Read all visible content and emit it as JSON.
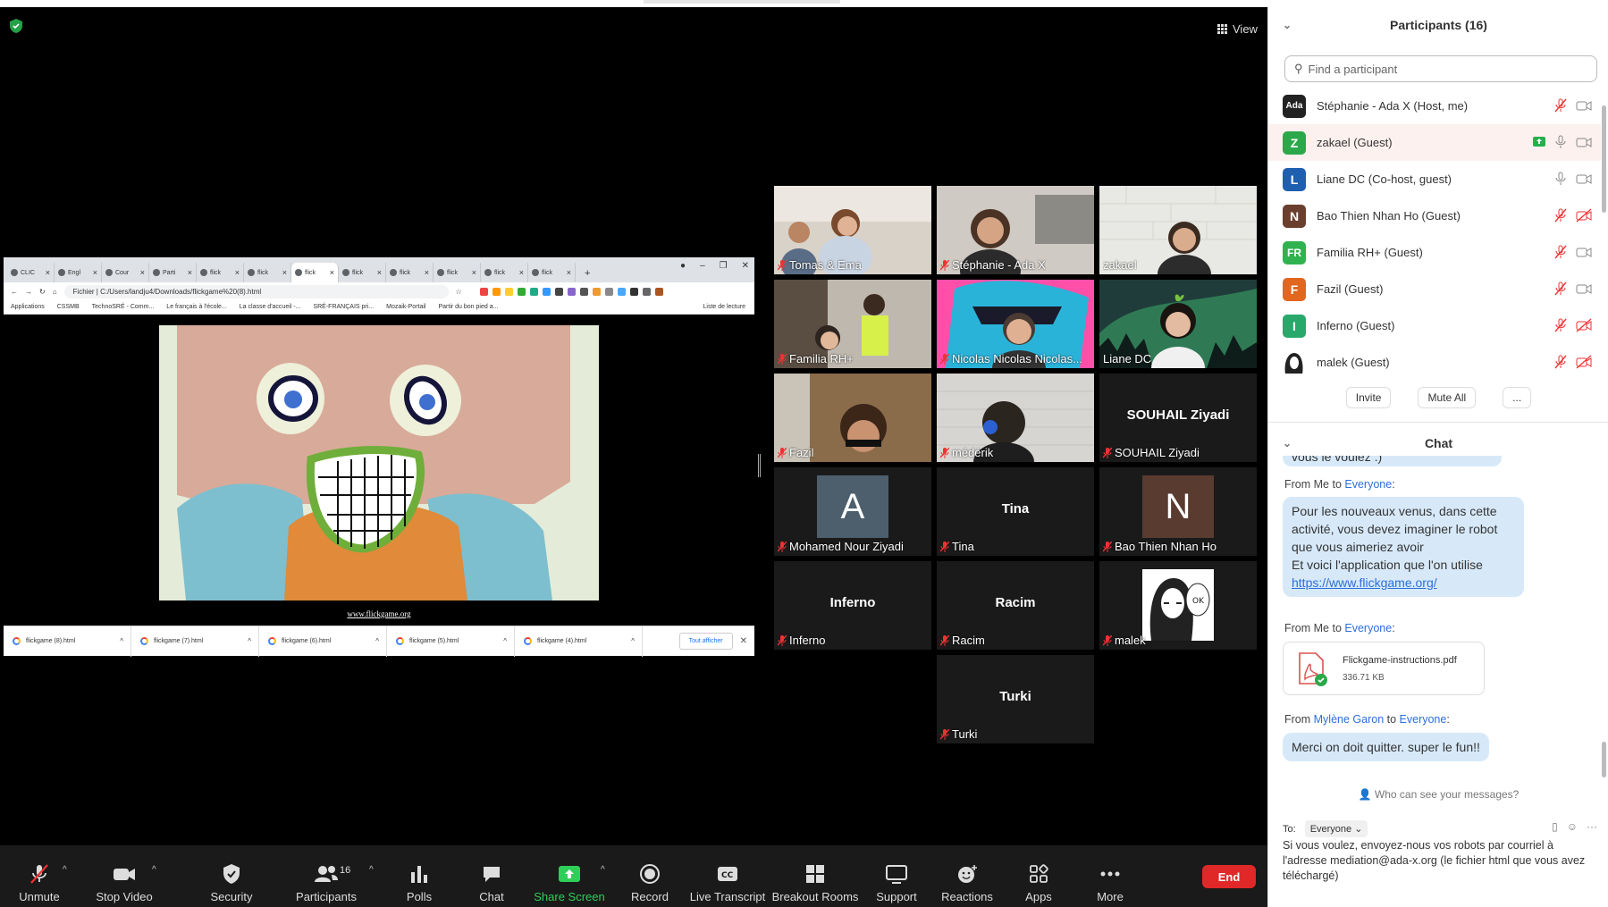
{
  "colors": {
    "accent": "#2d6fdb",
    "end": "#e02828",
    "share_green": "#2ecf59",
    "speaking": "#e8e86a"
  },
  "meeting": {
    "view_label": "View"
  },
  "browser": {
    "tabs": [
      "CLIC",
      "Engl",
      "Cour",
      "Parti",
      "flick",
      "flick",
      "flick",
      "flick",
      "flick",
      "flick",
      "flick",
      "flick"
    ],
    "new_tab": "+",
    "address": "Fichier | C:/Users/landju4/Downloads/flickgame%20(8).html",
    "bookmarks": [
      "Applications",
      "CSSMB",
      "TechnoSRÉ - Comm...",
      "Le français à l'école...",
      "La classe d'accueil -...",
      "SRÉ-FRANÇAIS pri...",
      "Mozaik-Portail",
      "Partir du bon pied a..."
    ],
    "reading_list": "Liste de lecture",
    "page_link": "www.flickgame.org",
    "downloads": [
      "flickgame (8).html",
      "flickgame (7).html",
      "flickgame (6).html",
      "flickgame (5).html",
      "flickgame (4).html"
    ],
    "show_all": "Tout afficher"
  },
  "tiles": [
    {
      "name": "Tomas & Ema",
      "big": ""
    },
    {
      "name": "Stéphanie - Ada X",
      "big": ""
    },
    {
      "name": "zakael",
      "big": ""
    },
    {
      "name": "Familia RH+",
      "big": ""
    },
    {
      "name": "Nicolas Nicolas Nicolas...",
      "big": ""
    },
    {
      "name": "Liane DC",
      "big": ""
    },
    {
      "name": "Fazil",
      "big": ""
    },
    {
      "name": "médérik",
      "big": ""
    },
    {
      "name": "SOUHAIL  Ziyadi",
      "big": "SOUHAIL  Ziyadi"
    },
    {
      "name": "Mohamed Nour Ziyadi",
      "avatar": "A"
    },
    {
      "name": "Tina",
      "big": "Tina"
    },
    {
      "name": "Bao Thien Nhan Ho",
      "avatar": "N"
    },
    {
      "name": "Inferno",
      "big": "Inferno"
    },
    {
      "name": "Racim",
      "big": "Racim"
    },
    {
      "name": "malek",
      "big": ""
    },
    {
      "name": "Turki",
      "big": "Turki"
    }
  ],
  "toolbar": {
    "unmute": "Unmute",
    "stop_video": "Stop Video",
    "security": "Security",
    "participants": "Participants",
    "participants_count": "16",
    "polls": "Polls",
    "chat": "Chat",
    "share_screen": "Share Screen",
    "record": "Record",
    "live_transcript": "Live Transcript",
    "breakout_rooms": "Breakout Rooms",
    "support": "Support",
    "reactions": "Reactions",
    "apps": "Apps",
    "more": "More",
    "end": "End"
  },
  "participants_panel": {
    "title": "Participants (16)",
    "search_placeholder": "Find a participant",
    "list": [
      {
        "initial": "Ada",
        "name": "Stéphanie - Ada X (Host, me)",
        "color": "#222222"
      },
      {
        "initial": "Z",
        "name": "zakael (Guest)",
        "color": "#2ba84a"
      },
      {
        "initial": "L",
        "name": "Liane DC (Co-host, guest)",
        "color": "#1f5fb0"
      },
      {
        "initial": "N",
        "name": "Bao Thien Nhan Ho (Guest)",
        "color": "#6b3f2e"
      },
      {
        "initial": "FR",
        "name": "Familia RH+ (Guest)",
        "color": "#2fb24f"
      },
      {
        "initial": "F",
        "name": "Fazil (Guest)",
        "color": "#e2661d"
      },
      {
        "initial": "I",
        "name": "Inferno (Guest)",
        "color": "#28a96b"
      },
      {
        "initial": "",
        "name": "malek (Guest)",
        "color": "#555555"
      }
    ],
    "invite": "Invite",
    "mute_all": "Mute All",
    "more": "..."
  },
  "chat": {
    "title": "Chat",
    "partial_msg": "vous le voulez :)",
    "msg1_from_prefix": "From Me to ",
    "msg1_to": "Everyone",
    "msg1_lines": [
      "Pour les nouveaux venus, dans cette",
      "activité, vous devez imaginer le robot",
      "que vous aimeriez avoir",
      "Et voici l'application que l'on utilise"
    ],
    "msg1_link": "https://www.flickgame.org/",
    "msg2_from_prefix": "From Me to ",
    "msg2_to": "Everyone",
    "msg2_to_suffix": ":",
    "file_name": "Flickgame-instructions.pdf",
    "file_size": "336.71 KB",
    "msg3_from": "From ",
    "msg3_sender": "Mylène Garon",
    "msg3_mid": " to ",
    "msg3_to": "Everyone",
    "msg3_suffix": ":",
    "msg3_text": "Merci on doit quitter. super le fun!!",
    "who_can_see": "Who can see your messages?",
    "to_label": "To:",
    "to_value": "Everyone",
    "draft": "Si vous voulez, envoyez-nous vos robots par courriel à l'adresse mediation@ada-x.org (le fichier html que vous avez téléchargé)"
  }
}
